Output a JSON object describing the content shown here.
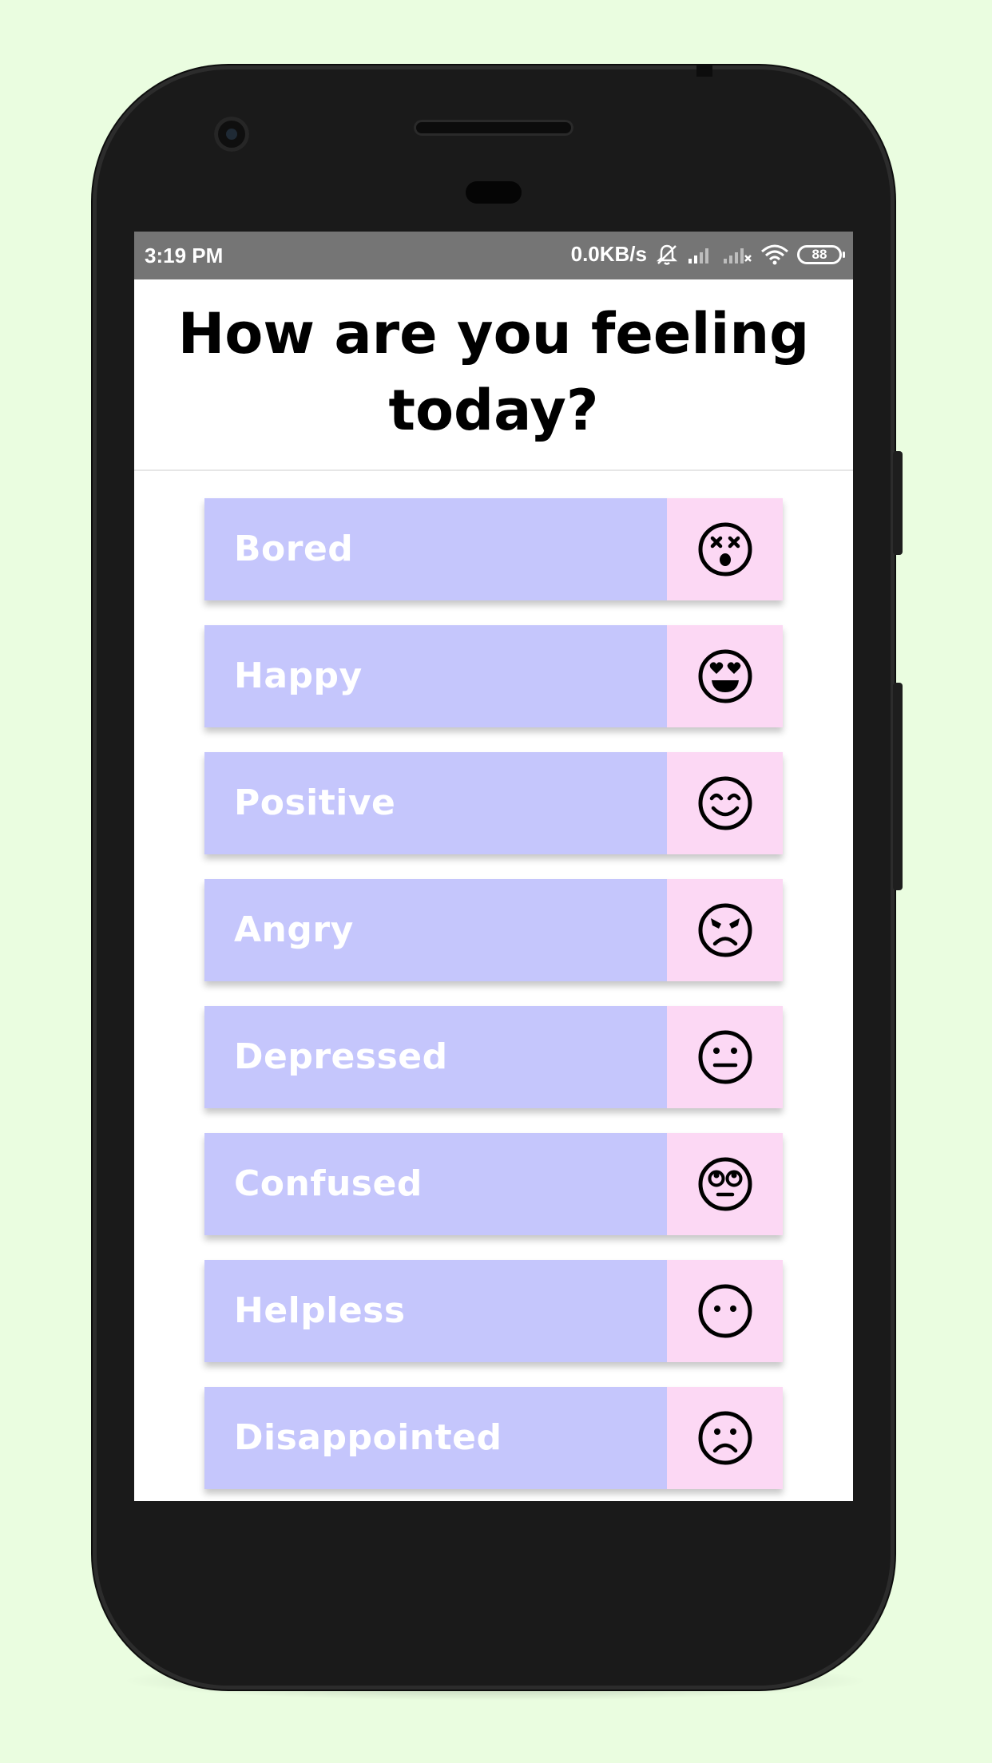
{
  "status_bar": {
    "time": "3:19 PM",
    "network_speed": "0.0KB/s",
    "battery_level": "88",
    "icons": [
      "bell-muted-icon",
      "signal-icon",
      "signal-x-icon",
      "wifi-icon",
      "battery-icon"
    ]
  },
  "screen": {
    "title": "How are you feeling today?"
  },
  "moods": [
    {
      "label": "Bored",
      "icon": "dizzy-face-icon"
    },
    {
      "label": "Happy",
      "icon": "heart-eyes-face-icon"
    },
    {
      "label": "Positive",
      "icon": "smiling-face-icon"
    },
    {
      "label": "Angry",
      "icon": "angry-face-icon"
    },
    {
      "label": "Depressed",
      "icon": "neutral-face-icon"
    },
    {
      "label": "Confused",
      "icon": "rolling-eyes-face-icon"
    },
    {
      "label": "Helpless",
      "icon": "blank-face-icon"
    },
    {
      "label": "Disappointed",
      "icon": "frowning-face-icon"
    }
  ],
  "colors": {
    "background": "#eafde0",
    "status_bar": "#757575",
    "mood_label_bg": "#c5c6fc",
    "mood_icon_bg": "#fcd8f4",
    "mood_label_text": "#ffffff"
  }
}
